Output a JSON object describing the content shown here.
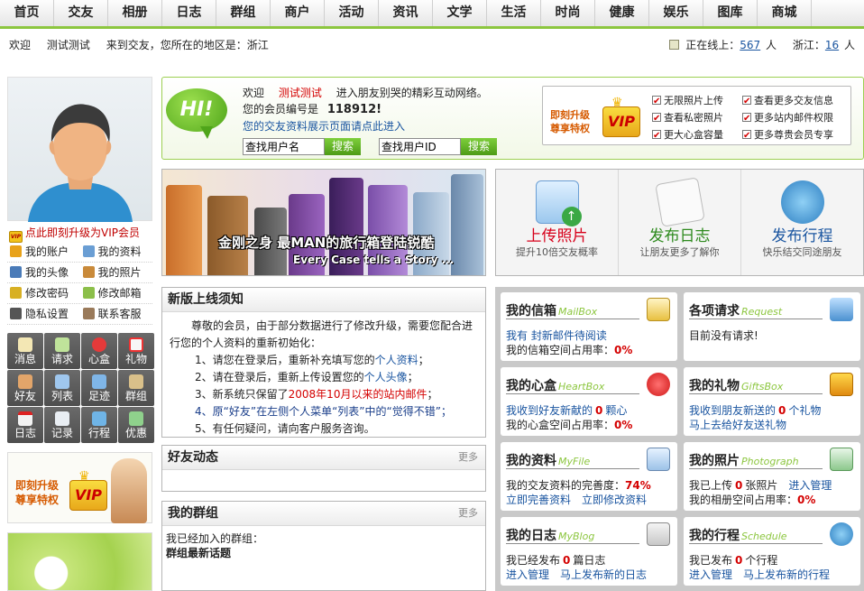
{
  "nav": [
    "首页",
    "交友",
    "相册",
    "日志",
    "群组",
    "商户",
    "活动",
    "资讯",
    "文学",
    "生活",
    "时尚",
    "健康",
    "娱乐",
    "图库",
    "商城"
  ],
  "infobar": {
    "greeting": "欢迎",
    "username": "测试测试",
    "region_text": "来到交友，您所在的地区是：浙江",
    "online_label": "正在线上：",
    "online_count": "567",
    "unit1": "人",
    "region_label": "浙江：",
    "region_count": "16",
    "unit2": "人"
  },
  "sidebar": {
    "vip_link": "点此即刻升级为VIP会员",
    "menu": [
      [
        "我的账户",
        "我的资料"
      ],
      [
        "我的头像",
        "我的照片"
      ],
      [
        "修改密码",
        "修改邮箱"
      ],
      [
        "隐私设置",
        "联系客服"
      ]
    ],
    "grid": [
      "消息",
      "请求",
      "心盒",
      "礼物",
      "好友",
      "列表",
      "足迹",
      "群组",
      "日志",
      "记录",
      "行程",
      "优惠"
    ],
    "promo_line1": "即刻升级",
    "promo_line2": "尊享特权",
    "promo_badge": "VIP"
  },
  "welcome": {
    "hi": "HI!",
    "line1_pre": "欢迎",
    "line1_user": "测试测试",
    "line1_post": "进入朋友别哭的精彩互动网络。",
    "member_label": "您的会员编号是",
    "member_id": "118912!",
    "profile_link": "您的交友资料展示页面请点此进入",
    "search1_placeholder": "查找用户名",
    "search2_placeholder": "查找用户ID",
    "search_btn": "搜索"
  },
  "vip_upgrade": {
    "line1": "即刻升级",
    "line2": "尊享特权",
    "badge": "VIP",
    "perks": [
      "无限照片上传",
      "查看更多交友信息",
      "查看私密照片",
      "更多站内邮件权限",
      "更大心盒容量",
      "更多尊贵会员专享"
    ]
  },
  "banner": {
    "headline": "金刚之身  最MAN的旅行箱登陆锐酷",
    "sub": "Every Case tells a Story ..."
  },
  "quick_actions": [
    {
      "title": "上传照片",
      "sub": "提升10倍交友概率",
      "color": "#d7001a"
    },
    {
      "title": "发布日志",
      "sub": "让朋友更多了解你",
      "color": "#2e8a1e"
    },
    {
      "title": "发布行程",
      "sub": "快乐结交同途朋友",
      "color": "#1a55a0"
    }
  ],
  "notice": {
    "title": "新版上线须知",
    "intro": "尊敬的会员，由于部分数据进行了修改升级，需要您配合进行您的个人资料的重新初始化：",
    "item1_pre": "1、请您在登录后，重新补充填写您的",
    "item1_link": "个人资料",
    "item1_post": "；",
    "item2_pre": "2、请在登录后，重新上传设置您的",
    "item2_link": "个人头像",
    "item2_post": "；",
    "item3_pre": "3、新系统只保留了",
    "item3_red": "2008年10月以来的站内邮件",
    "item3_post": "；",
    "item4": "4、原“好友”在左侧个人菜单“列表”中的“觉得不错”；",
    "item5": "5、有任何疑问，请向客户服务咨询。"
  },
  "friends": {
    "title": "好友动态",
    "more": "更多"
  },
  "groups": {
    "title": "我的群组",
    "more": "更多",
    "line1": "我已经加入的群组：",
    "line2": "群组最新话题"
  },
  "cards": {
    "mailbox": {
      "title": "我的信箱",
      "en": "MailBox",
      "link1": "我有",
      "link2": "封新邮件待阅读",
      "usage_label": "我的信箱空间占用率：",
      "usage": "0%"
    },
    "request": {
      "title": "各项请求",
      "en": "Request",
      "text": "目前没有请求!"
    },
    "heartbox": {
      "title": "我的心盒",
      "en": "HeartBox",
      "line1_pre": "我收到好友新献的",
      "count": "0",
      "line1_post": "颗心",
      "usage_label": "我的心盒空间占用率：",
      "usage": "0%"
    },
    "gifts": {
      "title": "我的礼物",
      "en": "GiftsBox",
      "line1_pre": "我收到朋友新送的",
      "count": "0",
      "line1_post": "个礼物",
      "link": "马上去给好友送礼物"
    },
    "profile": {
      "title": "我的资料",
      "en": "MyFile",
      "label": "我的交友资料的完善度：",
      "pct": "74%",
      "link1": "立即完善资料",
      "link2": "立即修改资料"
    },
    "photos": {
      "title": "我的照片",
      "en": "Photograph",
      "line1_pre": "我已上传",
      "count": "0",
      "line1_post": "张照片",
      "link": "进入管理",
      "usage_label": "我的相册空间占用率：",
      "usage": "0%"
    },
    "blog": {
      "title": "我的日志",
      "en": "MyBlog",
      "line1_pre": "我已经发布",
      "count": "0",
      "line1_post": "篇日志",
      "link1": "进入管理",
      "link2": "马上发布新的日志"
    },
    "schedule": {
      "title": "我的行程",
      "en": "Schedule",
      "line1_pre": "我已发布",
      "count": "0",
      "line1_post": "个行程",
      "link1": "进入管理",
      "link2": "马上发布新的行程"
    }
  }
}
